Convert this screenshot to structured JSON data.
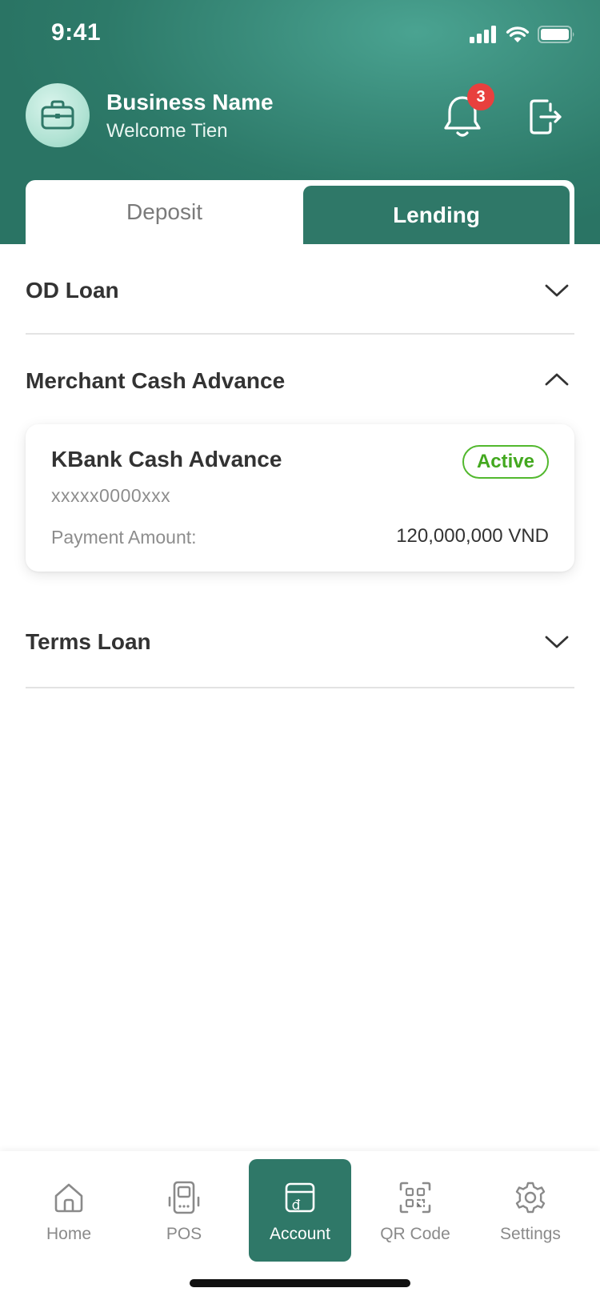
{
  "status_bar": {
    "time": "9:41"
  },
  "profile": {
    "business_name": "Business Name",
    "welcome": "Welcome Tien",
    "notification_count": "3",
    "avatar_icon": "briefcase-icon"
  },
  "tabs": [
    {
      "label": "Deposit",
      "selected": false
    },
    {
      "label": "Lending",
      "selected": true
    }
  ],
  "sections": {
    "od_loan": {
      "title": "OD Loan",
      "expanded": false
    },
    "merchant": {
      "title": "Merchant Cash Advance",
      "expanded": true
    },
    "terms_loan": {
      "title": "Terms Loan",
      "expanded": false
    }
  },
  "card": {
    "title": "KBank Cash Advance",
    "status": "Active",
    "account": "xxxxx0000xxx",
    "payment_label": "Payment Amount:",
    "payment_value": "120,000,000 VND"
  },
  "nav": [
    {
      "label": "Home",
      "icon": "home-icon",
      "active": false
    },
    {
      "label": "POS",
      "icon": "pos-icon",
      "active": false
    },
    {
      "label": "Account",
      "icon": "account-icon",
      "active": true
    },
    {
      "label": "QR Code",
      "icon": "qr-code-icon",
      "active": false
    },
    {
      "label": "Settings",
      "icon": "gear-icon",
      "active": false
    }
  ],
  "colors": {
    "primary": "#2f7868",
    "header_gradient_light": "#4aa391",
    "badge": "#e8403e",
    "active_status": "#43a81f"
  }
}
